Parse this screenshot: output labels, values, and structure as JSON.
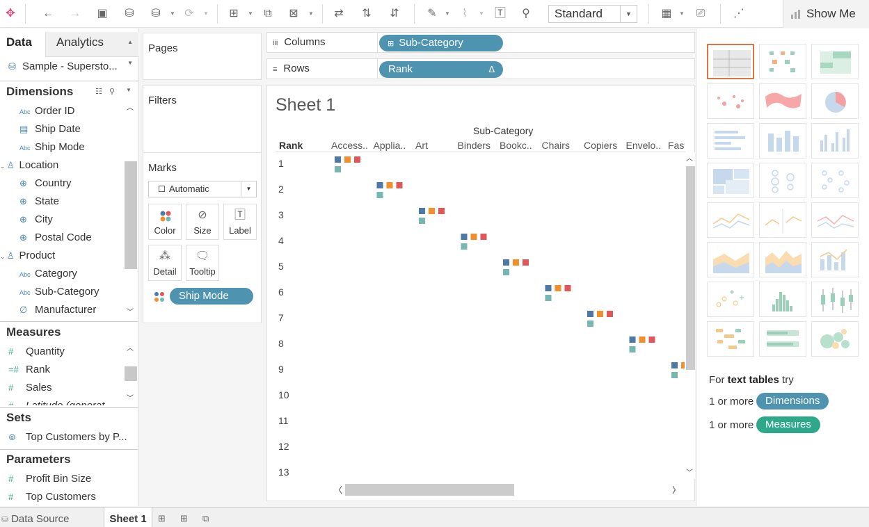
{
  "toolbar": {
    "fit_mode": "Standard",
    "show_me_label": "Show Me"
  },
  "data_pane": {
    "tab_data": "Data",
    "tab_analytics": "Analytics",
    "datasource": "Sample - Supersto...",
    "dimensions_header": "Dimensions",
    "dimensions": [
      {
        "label": "Order ID",
        "icon": "abc-icon"
      },
      {
        "label": "Ship Date",
        "icon": "calendar-icon"
      },
      {
        "label": "Ship Mode",
        "icon": "abc-icon"
      },
      {
        "label": "Location",
        "icon": "hierarchy-icon"
      },
      {
        "label": "Country",
        "icon": "globe-icon"
      },
      {
        "label": "State",
        "icon": "globe-icon"
      },
      {
        "label": "City",
        "icon": "globe-icon"
      },
      {
        "label": "Postal Code",
        "icon": "globe-icon"
      },
      {
        "label": "Product",
        "icon": "hierarchy-icon"
      },
      {
        "label": "Category",
        "icon": "abc-icon"
      },
      {
        "label": "Sub-Category",
        "icon": "abc-icon"
      },
      {
        "label": "Manufacturer",
        "icon": "paperclip-icon"
      }
    ],
    "measures_header": "Measures",
    "measures": [
      {
        "label": "Quantity",
        "icon": "hash-icon"
      },
      {
        "label": "Rank",
        "icon": "calc-hash-icon"
      },
      {
        "label": "Sales",
        "icon": "hash-icon"
      },
      {
        "label": "Latitude (generat...",
        "icon": "hash-icon"
      }
    ],
    "sets_header": "Sets",
    "sets": [
      {
        "label": "Top Customers by P...",
        "icon": "set-icon"
      }
    ],
    "parameters_header": "Parameters",
    "parameters": [
      {
        "label": "Profit Bin Size",
        "icon": "hash-icon"
      },
      {
        "label": "Top Customers",
        "icon": "hash-icon"
      }
    ]
  },
  "cards": {
    "pages": "Pages",
    "filters": "Filters",
    "marks": "Marks",
    "mark_type": "Automatic",
    "buttons": [
      "Color",
      "Size",
      "Label",
      "Detail",
      "Tooltip"
    ],
    "color_pill": "Ship Mode"
  },
  "shelves": {
    "columns_label": "Columns",
    "rows_label": "Rows",
    "columns_pill": "Sub-Category",
    "rows_pill": "Rank",
    "rows_pill_delta": "Δ"
  },
  "view": {
    "title": "Sheet 1",
    "column_header": "Sub-Category",
    "row_header": "Rank",
    "columns": [
      "Access..",
      "Applia..",
      "Art",
      "Binders",
      "Bookc..",
      "Chairs",
      "Copiers",
      "Envelo..",
      "Fast"
    ],
    "rows": [
      "1",
      "2",
      "3",
      "4",
      "5",
      "6",
      "7",
      "8",
      "9",
      "10",
      "11",
      "12",
      "13"
    ]
  },
  "colors": {
    "ship_first_class": "#4e79a7",
    "ship_second_class": "#f28e2b",
    "ship_standard": "#e15759",
    "ship_same_day": "#76b7b2",
    "pill_blue": "#4e94b0",
    "pill_green": "#2ea88a",
    "active_thumb": "#d97742"
  },
  "showme": {
    "hint_prefix": "For",
    "hint_bold": "text tables",
    "hint_suffix": "try",
    "req_prefix": "1 or more",
    "req_dim": "Dimensions",
    "req_meas": "Measures"
  },
  "bottom": {
    "datasource_tab": "Data Source",
    "sheet_tab": "Sheet 1"
  }
}
